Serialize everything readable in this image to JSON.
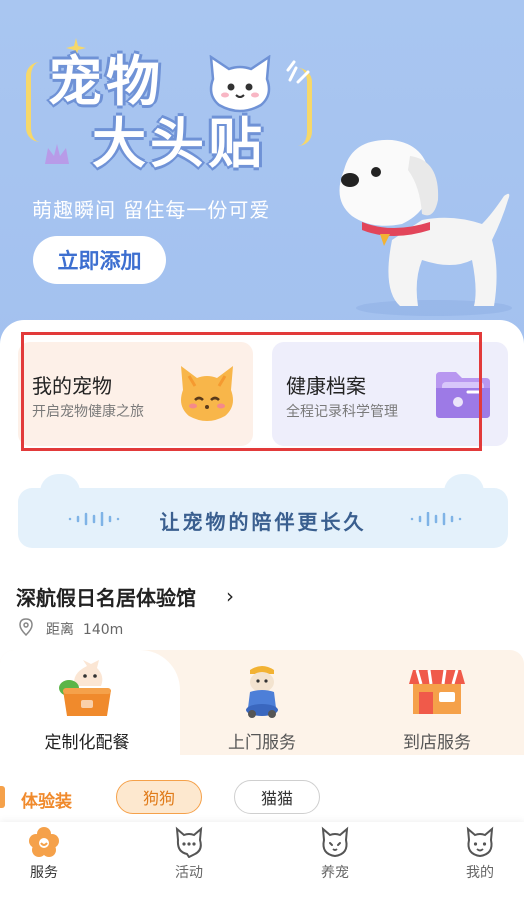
{
  "hero": {
    "title_line1": "宠物",
    "title_line2": "大头贴",
    "subtitle": "萌趣瞬间 留住每一份可爱",
    "cta_label": "立即添加"
  },
  "cards": [
    {
      "title": "我的宠物",
      "subtitle": "开启宠物健康之旅",
      "icon": "cat-face-icon"
    },
    {
      "title": "健康档案",
      "subtitle": "全程记录科学管理",
      "icon": "folder-icon"
    }
  ],
  "slogan": "让宠物的陪伴更长久",
  "store": {
    "name": "深航假日名居体验馆",
    "distance_label": "距离",
    "distance_value": "140m"
  },
  "services": [
    {
      "label": "定制化配餐",
      "icon": "meal-cat-icon",
      "active": true
    },
    {
      "label": "上门服务",
      "icon": "delivery-dog-icon",
      "active": false
    },
    {
      "label": "到店服务",
      "icon": "store-icon",
      "active": false
    }
  ],
  "filter": {
    "label": "体验装",
    "chips": [
      {
        "label": "狗狗",
        "selected": true
      },
      {
        "label": "猫猫",
        "selected": false
      }
    ]
  },
  "nav": [
    {
      "label": "服务",
      "icon": "flower-paw-icon",
      "active": true
    },
    {
      "label": "活动",
      "icon": "cat-chat-icon",
      "active": false
    },
    {
      "label": "养宠",
      "icon": "cat-outline-icon",
      "active": false
    },
    {
      "label": "我的",
      "icon": "cat-profile-icon",
      "active": false
    }
  ],
  "colors": {
    "hero_bg": "#a9c6f1",
    "accent_orange": "#f5a14a",
    "highlight_frame": "#e23a3a",
    "slogan_bg": "#e4f1fb"
  }
}
